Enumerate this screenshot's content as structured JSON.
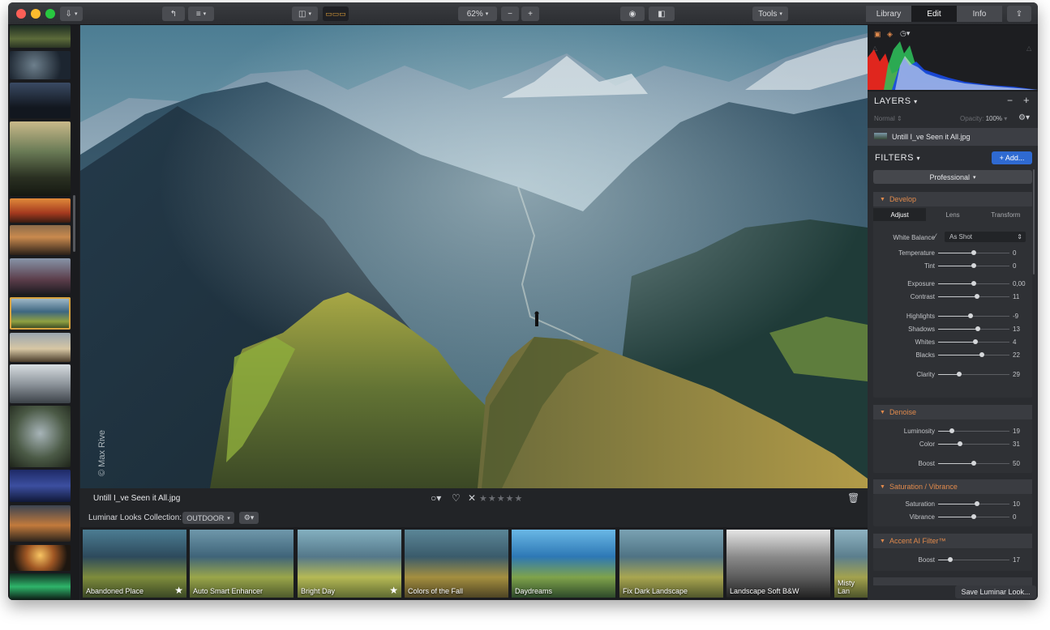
{
  "toolbar": {
    "zoom": "62%",
    "tools": "Tools",
    "tabs": [
      "Library",
      "Edit",
      "Info"
    ],
    "active_tab": "Edit"
  },
  "photo": {
    "filename": "Untill I_ve Seen it All.jpg",
    "credit": "© Max Rive",
    "rating_stars": "★★★★★"
  },
  "looks_bar": {
    "label": "Luminar Looks Collection:",
    "collection": "OUTDOOR",
    "items": [
      {
        "label": "Abandoned Place",
        "starred": true
      },
      {
        "label": "Auto Smart Enhancer",
        "starred": false
      },
      {
        "label": "Bright Day",
        "starred": true
      },
      {
        "label": "Colors of the Fall",
        "starred": false
      },
      {
        "label": "Daydreams",
        "starred": false
      },
      {
        "label": "Fix Dark Landscape",
        "starred": false
      },
      {
        "label": "Landscape Soft B&W",
        "starred": false
      },
      {
        "label": "Misty Lan",
        "starred": false
      }
    ],
    "save_label": "Save Luminar Look..."
  },
  "panel": {
    "layers_title": "LAYERS",
    "blend_mode": "Normal",
    "opacity_label": "Opacity:",
    "opacity_value": "100%",
    "layer_name": "Untill I_ve Seen it All.jpg",
    "filters_title": "FILTERS",
    "add_button": "+ Add...",
    "workspace": "Professional",
    "develop": {
      "title": "Develop",
      "tabs": [
        "Adjust",
        "Lens",
        "Transform"
      ],
      "white_balance_label": "White Balance",
      "white_balance_value": "As Shot",
      "sliders": [
        {
          "name": "Temperature",
          "value": "0",
          "pos": 0.5
        },
        {
          "name": "Tint",
          "value": "0",
          "pos": 0.5
        },
        {
          "name": "Exposure",
          "value": "0,00",
          "pos": 0.5
        },
        {
          "name": "Contrast",
          "value": "11",
          "pos": 0.55
        },
        {
          "name": "Highlights",
          "value": "-9",
          "pos": 0.45
        },
        {
          "name": "Shadows",
          "value": "13",
          "pos": 0.56
        },
        {
          "name": "Whites",
          "value": "4",
          "pos": 0.52
        },
        {
          "name": "Blacks",
          "value": "22",
          "pos": 0.61
        },
        {
          "name": "Clarity",
          "value": "29",
          "pos": 0.29
        }
      ]
    },
    "denoise": {
      "title": "Denoise",
      "sliders": [
        {
          "name": "Luminosity",
          "value": "19",
          "pos": 0.19
        },
        {
          "name": "Color",
          "value": "31",
          "pos": 0.31
        },
        {
          "name": "Boost",
          "value": "50",
          "pos": 0.5
        }
      ]
    },
    "saturation": {
      "title": "Saturation / Vibrance",
      "sliders": [
        {
          "name": "Saturation",
          "value": "10",
          "pos": 0.55
        },
        {
          "name": "Vibrance",
          "value": "0",
          "pos": 0.5
        }
      ]
    },
    "accent": {
      "title": "Accent AI Filter™",
      "sliders": [
        {
          "name": "Boost",
          "value": "17",
          "pos": 0.17
        }
      ]
    }
  }
}
